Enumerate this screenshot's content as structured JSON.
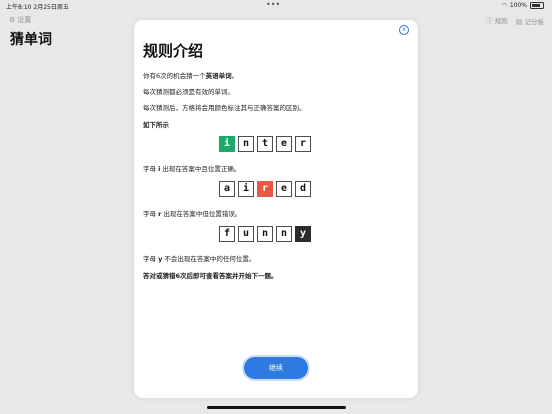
{
  "status_bar": {
    "time": "上午8:10  2月25日周五",
    "dots": "•••",
    "battery_percent": "100%"
  },
  "background": {
    "settings_label": "设置",
    "title": "猜单词",
    "rules_label": "规则",
    "records_label": "记分板"
  },
  "modal": {
    "close_symbol": "x",
    "title": "规则介绍",
    "intro_prefix": "你有6次的机会猜一个",
    "intro_bold": "英语单词",
    "intro_suffix": "。",
    "line2": "每次猜测都必须是有效的单词。",
    "line3": "每次猜测后，方格将会用颜色标注其与正确答案的区别。",
    "examples_heading": "如下所示",
    "example1": {
      "letters": [
        "i",
        "n",
        "t",
        "e",
        "r"
      ],
      "states": [
        "correct",
        "none",
        "none",
        "none",
        "none"
      ],
      "caption_prefix": "字母 ",
      "caption_letter": "i",
      "caption_suffix": " 出现在答案中且位置正确。"
    },
    "example2": {
      "letters": [
        "a",
        "i",
        "r",
        "e",
        "d"
      ],
      "states": [
        "none",
        "none",
        "present",
        "none",
        "none"
      ],
      "caption_prefix": "字母 ",
      "caption_letter": "r",
      "caption_suffix": " 出现在答案中但位置错误。"
    },
    "example3": {
      "letters": [
        "f",
        "u",
        "n",
        "n",
        "y"
      ],
      "states": [
        "none",
        "none",
        "none",
        "none",
        "absent"
      ],
      "caption_prefix": "字母 ",
      "caption_letter": "y",
      "caption_suffix": " 不会出现在答案中的任何位置。"
    },
    "final_note": "答对或猜错6次后即可查看答案并开始下一题。",
    "continue_label": "继续"
  },
  "colors": {
    "correct": "#1da96c",
    "present": "#ea5745",
    "absent": "#2b2b2b",
    "accent": "#2d7be2"
  }
}
